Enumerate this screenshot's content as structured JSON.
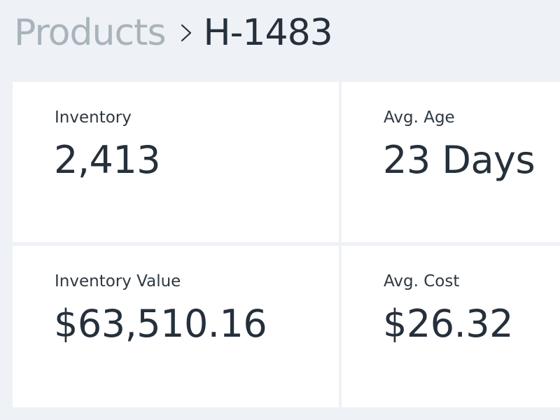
{
  "breadcrumb": {
    "parent": "Products",
    "separator_icon": "chevron-right-icon",
    "current": "H-1483"
  },
  "stats": {
    "inventory": {
      "label": "Inventory",
      "value": "2,413"
    },
    "avg_age": {
      "label": "Avg. Age",
      "value": "23 Days"
    },
    "inventory_value": {
      "label": "Inventory Value",
      "value": "$63,510.16"
    },
    "avg_cost": {
      "label": "Avg. Cost",
      "value": "$26.32"
    }
  },
  "colors": {
    "background": "#eef1f5",
    "card": "#ffffff",
    "text_primary": "#26303b",
    "text_muted": "#a9b3bc"
  }
}
